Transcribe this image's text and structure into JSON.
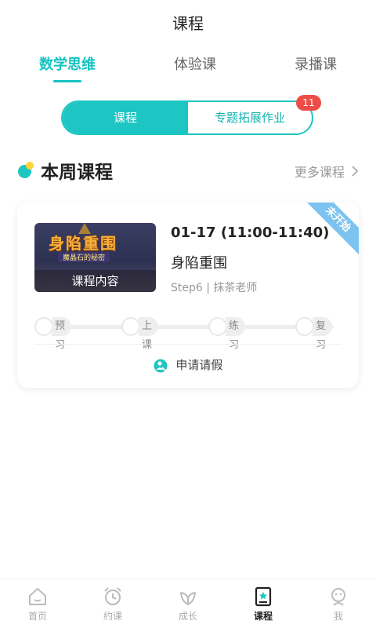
{
  "header": {
    "title": "课程"
  },
  "tabs": [
    {
      "label": "数学思维",
      "active": true
    },
    {
      "label": "体验课",
      "active": false
    },
    {
      "label": "录播课",
      "active": false
    }
  ],
  "segment": {
    "left_label": "课程",
    "right_label": "专题拓展作业",
    "right_badge": "11"
  },
  "section": {
    "title": "本周课程",
    "more_label": "更多课程"
  },
  "course": {
    "thumb_title": "身陷重围",
    "thumb_subtitle": "魔晶石的秘密",
    "thumb_caption": "课程内容",
    "time": "01-17 (11:00-11:40)",
    "name": "身陷重围",
    "meta": "Step6 | 抹茶老师",
    "status": "未开始",
    "steps": [
      "预习",
      "上课",
      "练习",
      "复习"
    ],
    "leave_label": "申请请假"
  },
  "nav": [
    {
      "label": "首页",
      "icon": "home-icon"
    },
    {
      "label": "约课",
      "icon": "alarm-clock-icon"
    },
    {
      "label": "成长",
      "icon": "leaf-icon"
    },
    {
      "label": "课程",
      "icon": "course-book-icon",
      "active": true
    },
    {
      "label": "我",
      "icon": "profile-icon"
    }
  ],
  "colors": {
    "accent": "#1ec6c3",
    "badge": "#ef4c47",
    "ribbon": "#7cc3ef",
    "dot_yellow": "#fcd33a"
  }
}
